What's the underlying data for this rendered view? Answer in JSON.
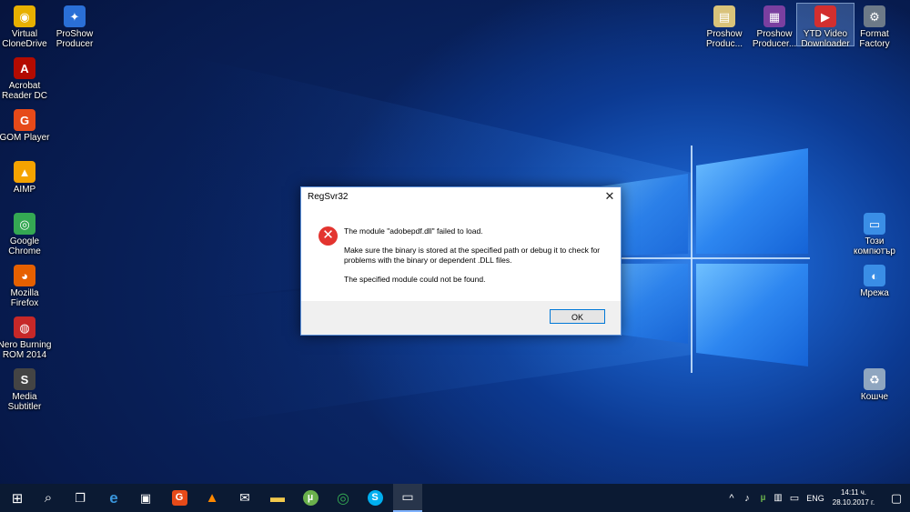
{
  "desktop_icons_left": [
    {
      "id": "virtual-clonedrive",
      "line1": "Virtual",
      "line2": "CloneDrive",
      "glyph": "◉",
      "color": "#e7b000"
    },
    {
      "id": "proshow-producer",
      "line1": "ProShow",
      "line2": "Producer",
      "glyph": "✦",
      "color": "#2a6fd6"
    },
    {
      "id": "acrobat-reader",
      "line1": "Acrobat",
      "line2": "Reader DC",
      "glyph": "A",
      "color": "#b30b00"
    },
    {
      "id": "gom-player",
      "line1": "GOM Player",
      "line2": "",
      "glyph": "G",
      "color": "#e64a19"
    },
    {
      "id": "aimp",
      "line1": "AIMP",
      "line2": "",
      "glyph": "▲",
      "color": "#f5a300"
    },
    {
      "id": "google-chrome",
      "line1": "Google",
      "line2": "Chrome",
      "glyph": "◎",
      "color": "#34a853"
    },
    {
      "id": "mozilla-firefox",
      "line1": "Mozilla",
      "line2": "Firefox",
      "glyph": "◕",
      "color": "#e66000"
    },
    {
      "id": "nero-burning-rom",
      "line1": "Nero Burning",
      "line2": "ROM 2014",
      "glyph": "◍",
      "color": "#c62828"
    },
    {
      "id": "media-subtitler",
      "line1": "Media",
      "line2": "Subtitler",
      "glyph": "S",
      "color": "#444444"
    }
  ],
  "desktop_icons_right": [
    {
      "id": "proshow-producer-1",
      "line1": "Proshow",
      "line2": "Produc...",
      "glyph": "▤",
      "color": "#d9c37a"
    },
    {
      "id": "proshow-producer-2",
      "line1": "Proshow",
      "line2": "Producer...",
      "glyph": "▦",
      "color": "#7a3fa0"
    },
    {
      "id": "ytd-video-downloader",
      "line1": "YTD Video",
      "line2": "Downloader",
      "glyph": "▶",
      "color": "#d32f2f"
    },
    {
      "id": "format-factory",
      "line1": "Format",
      "line2": "Factory",
      "glyph": "⚙",
      "color": "#6d7a88"
    },
    {
      "id": "this-pc",
      "line1": "Този",
      "line2": "компютър",
      "glyph": "▭",
      "color": "#3a8ee6"
    },
    {
      "id": "network",
      "line1": "Мрежа",
      "line2": "",
      "glyph": "◐",
      "color": "#3a8ee6"
    },
    {
      "id": "recycle-bin",
      "line1": "Кошче",
      "line2": "",
      "glyph": "♻",
      "color": "#8fa6c0"
    }
  ],
  "dialog": {
    "title": "RegSvr32",
    "close_glyph": "✕",
    "error_glyph": "✕",
    "message_1": "The module \"adobepdf.dll\" failed to load.",
    "message_2": "Make sure the binary is stored at the specified path or debug it to check for problems with the binary or dependent .DLL files.",
    "message_3": "The specified module could not be found.",
    "ok_label": "OK"
  },
  "taskbar": {
    "buttons": [
      {
        "id": "start",
        "glyph": "⊞",
        "color": "#ffffff"
      },
      {
        "id": "search",
        "glyph": "⌕",
        "color": "#ffffff"
      },
      {
        "id": "task-view",
        "glyph": "❐",
        "color": "#ffffff"
      },
      {
        "id": "edge",
        "glyph": "e",
        "color": "#3a96dd"
      },
      {
        "id": "store",
        "glyph": "▣",
        "color": "#ffffff"
      },
      {
        "id": "gom-player",
        "glyph": "G",
        "color": "#e64a19"
      },
      {
        "id": "vlc",
        "glyph": "▲",
        "color": "#ff8800"
      },
      {
        "id": "mail",
        "glyph": "✉",
        "color": "#ffffff"
      },
      {
        "id": "file-explorer",
        "glyph": "▬",
        "color": "#f2c94c"
      },
      {
        "id": "utorrent",
        "glyph": "µ",
        "color": "#6ab04c"
      },
      {
        "id": "chrome",
        "glyph": "◎",
        "color": "#34a853"
      },
      {
        "id": "skype",
        "glyph": "S",
        "color": "#00aff0"
      },
      {
        "id": "regsvr32-window",
        "glyph": "▭",
        "color": "#ffffff"
      }
    ],
    "tray_chevron": "^",
    "tray_speaker": "♪",
    "tray_utorrent": "µ",
    "tray_network": "▥",
    "tray_battery": "▭",
    "language": "ENG",
    "time": "14:11 ч.",
    "date": "28.10.2017 г.",
    "notifications_glyph": "▢"
  }
}
